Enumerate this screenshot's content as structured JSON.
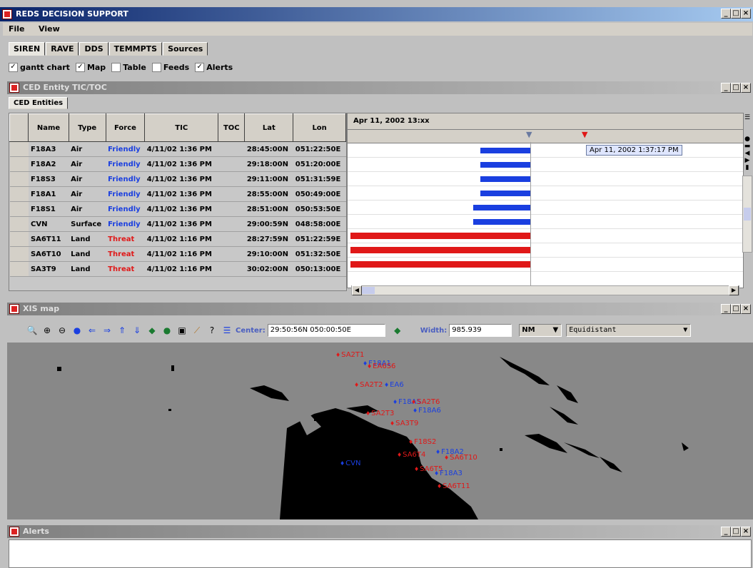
{
  "app": {
    "title": "REDS DECISION SUPPORT"
  },
  "menu": {
    "items": [
      "File",
      "View"
    ]
  },
  "tabs": [
    "SIREN",
    "RAVE",
    "DDS",
    "TEMMPTS",
    "Sources"
  ],
  "checkboxes": [
    {
      "label": "gantt chart",
      "checked": true
    },
    {
      "label": "Map",
      "checked": true
    },
    {
      "label": "Table",
      "checked": false
    },
    {
      "label": "Feeds",
      "checked": false
    },
    {
      "label": "Alerts",
      "checked": true
    }
  ],
  "ced": {
    "title": "CED Entity TIC/TOC",
    "tab": "CED Entities",
    "columns": [
      "Name",
      "Type",
      "Force",
      "TIC",
      "TOC",
      "Lat",
      "Lon"
    ],
    "rows": [
      {
        "name": "F18A3",
        "type": "Air",
        "force": "Friendly",
        "tic": "4/11/02 1:36 PM",
        "toc": "",
        "lat": "28:45:00N",
        "lon": "051:22:50E"
      },
      {
        "name": "F18A2",
        "type": "Air",
        "force": "Friendly",
        "tic": "4/11/02 1:36 PM",
        "toc": "",
        "lat": "29:18:00N",
        "lon": "051:20:00E"
      },
      {
        "name": "F18S3",
        "type": "Air",
        "force": "Friendly",
        "tic": "4/11/02 1:36 PM",
        "toc": "",
        "lat": "29:11:00N",
        "lon": "051:31:59E"
      },
      {
        "name": "F18A1",
        "type": "Air",
        "force": "Friendly",
        "tic": "4/11/02 1:36 PM",
        "toc": "",
        "lat": "28:55:00N",
        "lon": "050:49:00E"
      },
      {
        "name": "F18S1",
        "type": "Air",
        "force": "Friendly",
        "tic": "4/11/02 1:36 PM",
        "toc": "",
        "lat": "28:51:00N",
        "lon": "050:53:50E"
      },
      {
        "name": "CVN",
        "type": "Surface",
        "force": "Friendly",
        "tic": "4/11/02 1:36 PM",
        "toc": "",
        "lat": "29:00:59N",
        "lon": "048:58:00E"
      },
      {
        "name": "SA6T11",
        "type": "Land",
        "force": "Threat",
        "tic": "4/11/02 1:16 PM",
        "toc": "",
        "lat": "28:27:59N",
        "lon": "051:22:59E"
      },
      {
        "name": "SA6T10",
        "type": "Land",
        "force": "Threat",
        "tic": "4/11/02 1:16 PM",
        "toc": "",
        "lat": "29:10:00N",
        "lon": "051:32:50E"
      },
      {
        "name": "SA3T9",
        "type": "Land",
        "force": "Threat",
        "tic": "4/11/02 1:16 PM",
        "toc": "",
        "lat": "30:02:00N",
        "lon": "050:13:00E"
      }
    ],
    "gantt_header": "Apr 11, 2002 13:xx",
    "tooltip": "Apr 11, 2002 1:37:17 PM"
  },
  "map": {
    "title": "XIS map",
    "center_label": "Center:",
    "center_value": "29:50:56N 050:00:50E",
    "width_label": "Width:",
    "width_value": "985.939",
    "units": "NM",
    "projection": "Equidistant",
    "labels": [
      {
        "text": "SA2T1",
        "color": "red"
      },
      {
        "text": "F18A1",
        "color": "blue"
      },
      {
        "text": "EA6S6",
        "color": "red"
      },
      {
        "text": "SA2T2",
        "color": "red"
      },
      {
        "text": "EA6",
        "color": "blue"
      },
      {
        "text": "F18A5",
        "color": "blue"
      },
      {
        "text": "SA2T6",
        "color": "red"
      },
      {
        "text": "SA2T3",
        "color": "red"
      },
      {
        "text": "F18A6",
        "color": "blue"
      },
      {
        "text": "SA3T9",
        "color": "red"
      },
      {
        "text": "F18S2",
        "color": "red"
      },
      {
        "text": "F18A2",
        "color": "blue"
      },
      {
        "text": "SA6T10",
        "color": "red"
      },
      {
        "text": "SA6T4",
        "color": "red"
      },
      {
        "text": "CVN",
        "color": "blue"
      },
      {
        "text": "SA6T5",
        "color": "red"
      },
      {
        "text": "F18A3",
        "color": "blue"
      },
      {
        "text": "SA6T11",
        "color": "red"
      }
    ]
  },
  "alerts": {
    "title": "Alerts"
  }
}
